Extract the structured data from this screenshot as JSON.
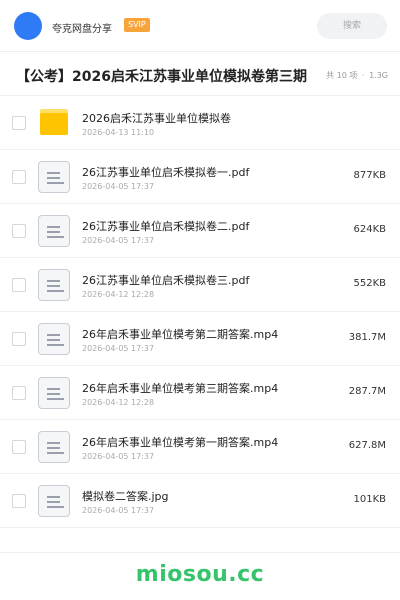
{
  "header": {
    "sharer": "夸克网盘分享",
    "badge": "SVIP",
    "search_placeholder": "搜索",
    "colors": {
      "avatar": "#2f7bf5",
      "badge": "#f7a53b"
    }
  },
  "share": {
    "title": "【公考】2026启禾江苏事业单位模拟卷第三期",
    "count": "共 10 项",
    "separator": "·",
    "total_size": "1.3G"
  },
  "files": [
    {
      "type": "folder",
      "icon": "folder-icon",
      "name": "2026启禾江苏事业单位模拟卷",
      "date": "2026-04-13 11:10",
      "size": ""
    },
    {
      "type": "file",
      "icon": "document-icon",
      "name": "26江苏事业单位启禾模拟卷一.pdf",
      "date": "2026-04-05 17:37",
      "size": "877KB"
    },
    {
      "type": "file",
      "icon": "document-icon",
      "name": "26江苏事业单位启禾模拟卷二.pdf",
      "date": "2026-04-05 17:37",
      "size": "624KB"
    },
    {
      "type": "file",
      "icon": "document-icon",
      "name": "26江苏事业单位启禾模拟卷三.pdf",
      "date": "2026-04-12 12:28",
      "size": "552KB"
    },
    {
      "type": "file",
      "icon": "document-icon",
      "name": "26年启禾事业单位模考第二期答案.mp4",
      "date": "2026-04-05 17:37",
      "size": "381.7M"
    },
    {
      "type": "file",
      "icon": "document-icon",
      "name": "26年启禾事业单位模考第三期答案.mp4",
      "date": "2026-04-12 12:28",
      "size": "287.7M"
    },
    {
      "type": "file",
      "icon": "document-icon",
      "name": "26年启禾事业单位模考第一期答案.mp4",
      "date": "2026-04-05 17:37",
      "size": "627.8M"
    },
    {
      "type": "file",
      "icon": "document-icon",
      "name": "模拟卷二答案.jpg",
      "date": "2026-04-05 17:37",
      "size": "101KB"
    }
  ],
  "watermark": {
    "text": "miosou.cc",
    "color": "#35c46a"
  }
}
